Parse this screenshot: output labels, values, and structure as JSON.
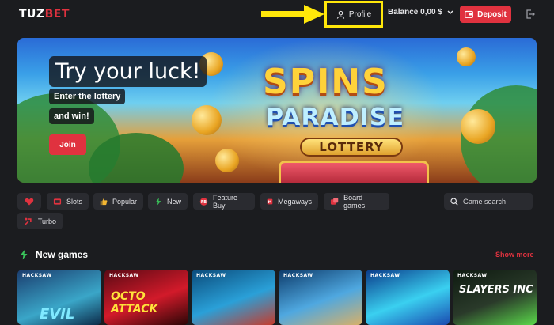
{
  "header": {
    "logo_part1": "TUZ",
    "logo_part2": "BET",
    "profile_label": "Profile",
    "balance_label": "Balance 0,00 $",
    "deposit_label": "Deposit"
  },
  "banner": {
    "title": "Try your luck!",
    "subtitle1": "Enter the lottery",
    "subtitle2": "and win!",
    "join_label": "Join",
    "logo_line1": "SPINS",
    "logo_line2": "PARADISE",
    "logo_line3": "LOTTERY"
  },
  "categories": [
    {
      "label": "Slots",
      "icon": "slot-machine-icon"
    },
    {
      "label": "Popular",
      "icon": "thumbs-up-icon"
    },
    {
      "label": "New",
      "icon": "lightning-icon"
    },
    {
      "label": "Feature Buy",
      "icon": "feature-buy-icon"
    },
    {
      "label": "Megaways",
      "icon": "megaways-icon"
    },
    {
      "label": "Board games",
      "icon": "board-games-icon"
    },
    {
      "label": "Turbo",
      "icon": "turbo-icon"
    }
  ],
  "favorites_icon": "heart-icon",
  "search": {
    "placeholder": "Game search"
  },
  "section": {
    "title": "New games",
    "show_more": "Show more"
  },
  "games": [
    {
      "provider": "HACKSAW",
      "title": "EVIL"
    },
    {
      "provider": "HACKSAW",
      "title": "OCTO ATTACK"
    },
    {
      "provider": "HACKSAW",
      "title": ""
    },
    {
      "provider": "HACKSAW",
      "title": ""
    },
    {
      "provider": "HACKSAW",
      "title": ""
    },
    {
      "provider": "HACKSAW",
      "title": "SLAYERS INC"
    }
  ],
  "colors": {
    "accent": "#e0323f",
    "highlight": "#ffe70a",
    "background": "#1b1c1f"
  }
}
